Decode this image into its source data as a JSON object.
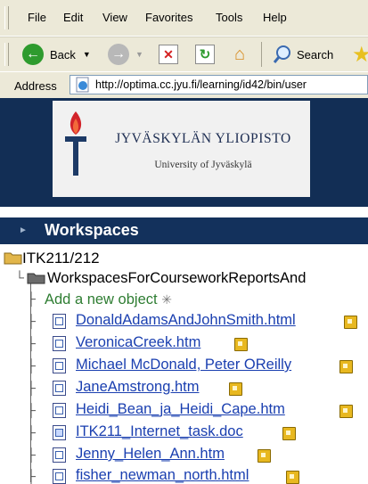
{
  "menu": {
    "items": [
      "File",
      "Edit",
      "View",
      "Favorites",
      "Tools",
      "Help"
    ]
  },
  "toolbar": {
    "back_label": "Back",
    "search_label": "Search"
  },
  "address": {
    "label": "Address",
    "url": "http://optima.cc.jyu.fi/learning/id42/bin/user"
  },
  "university": {
    "title": "JYVÄSKYLÄN YLIOPISTO",
    "subtitle": "University of Jyväskylä"
  },
  "workspaces": {
    "title": "Workspaces"
  },
  "tree": {
    "root": "ITK211/212",
    "sub": "WorkspacesForCourseworkReportsAnd",
    "add_link": "Add a new object",
    "files": [
      "DonaldAdamsAndJohnSmith.html",
      "VeronicaCreek.htm",
      "Michael McDonald, Peter OReilly",
      "JaneAmstrong.htm",
      "Heidi_Bean_ja_Heidi_Cape.htm",
      "ITK211_Internet_task.doc",
      "Jenny_Helen_Ann.htm",
      "fisher_newman_north.html"
    ]
  },
  "colors": {
    "header_bg": "#122e55",
    "link": "#1a3fb0",
    "add_link": "#2e7d32"
  }
}
